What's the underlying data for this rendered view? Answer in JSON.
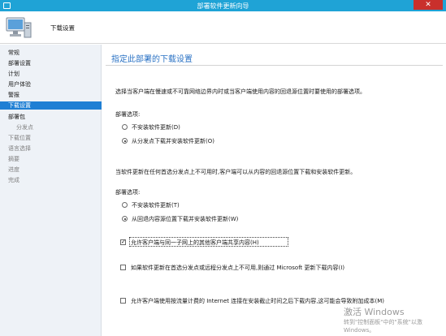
{
  "window": {
    "title": "部署软件更新向导",
    "close_glyph": "✕"
  },
  "header": {
    "page_title": "下载设置"
  },
  "sidebar": {
    "items": [
      {
        "label": "常规"
      },
      {
        "label": "部署设置"
      },
      {
        "label": "计划"
      },
      {
        "label": "用户体验"
      },
      {
        "label": "警报"
      },
      {
        "label": "下载设置"
      },
      {
        "label": "部署包"
      },
      {
        "label": "分发点"
      },
      {
        "label": "下载位置"
      },
      {
        "label": "语言选择"
      },
      {
        "label": "摘要"
      },
      {
        "label": "进度"
      },
      {
        "label": "完成"
      }
    ]
  },
  "main": {
    "heading": "指定此部署的下载设置",
    "intro": "选择当客户端在慢速或不可靠网络边界内时或当客户端使用内容的回退源位置时要使用的部署选项。",
    "group1": {
      "label": "部署选项:",
      "options": [
        "不安装软件更新(D)",
        "从分发点下载并安装软件更新(O)"
      ],
      "selected": 1
    },
    "fallback_text": "当软件更新在任何首选分发点上不可用时,客户端可以从内容的回退源位置下载和安装软件更新。",
    "group2": {
      "label": "部署选项:",
      "options": [
        "不安装软件更新(T)",
        "从回退内容源位置下载并安装软件更新(W)"
      ],
      "selected": 1
    },
    "checkboxes": [
      {
        "label": "允许客户端与同一子网上的其他客户端共享内容(H)",
        "checked": true
      },
      {
        "label": "如果软件更新在首选分发点或远程分发点上不可用,则通过 Microsoft 更新下载内容(I)",
        "checked": false
      },
      {
        "label": "允许客户端使用按流量计费的 Internet 连接在安装截止时间之后下载内容,这可能会导致附加成本(M)",
        "checked": false
      }
    ]
  },
  "watermark": {
    "line1": "激活 Windows",
    "line2": "转到\"控制面板\"中的\"系统\"以激",
    "line3": "Windows。"
  }
}
